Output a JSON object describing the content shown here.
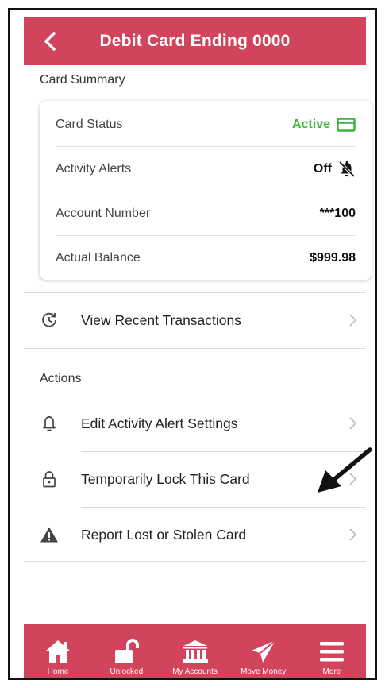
{
  "header": {
    "title": "Debit Card Ending 0000"
  },
  "summary": {
    "label": "Card Summary",
    "rows": [
      {
        "label": "Card Status",
        "value": "Active"
      },
      {
        "label": "Activity Alerts",
        "value": "Off"
      },
      {
        "label": "Account Number",
        "value": "***100"
      },
      {
        "label": "Actual Balance",
        "value": "$999.98"
      }
    ]
  },
  "recent": {
    "label": "View Recent Transactions"
  },
  "actions": {
    "label": "Actions",
    "items": [
      {
        "label": "Edit Activity Alert Settings",
        "icon": "bell-icon"
      },
      {
        "label": "Temporarily Lock This Card",
        "icon": "lock-icon"
      },
      {
        "label": "Report Lost or Stolen Card",
        "icon": "warning-icon"
      }
    ]
  },
  "tabs": [
    {
      "label": "Home",
      "icon": "home-icon"
    },
    {
      "label": "Unlocked",
      "icon": "unlocked-icon"
    },
    {
      "label": "My Accounts",
      "icon": "bank-icon"
    },
    {
      "label": "Move Money",
      "icon": "send-icon"
    },
    {
      "label": "More",
      "icon": "menu-icon"
    }
  ],
  "colors": {
    "brand": "#d2435c",
    "active": "#3cb43c"
  }
}
